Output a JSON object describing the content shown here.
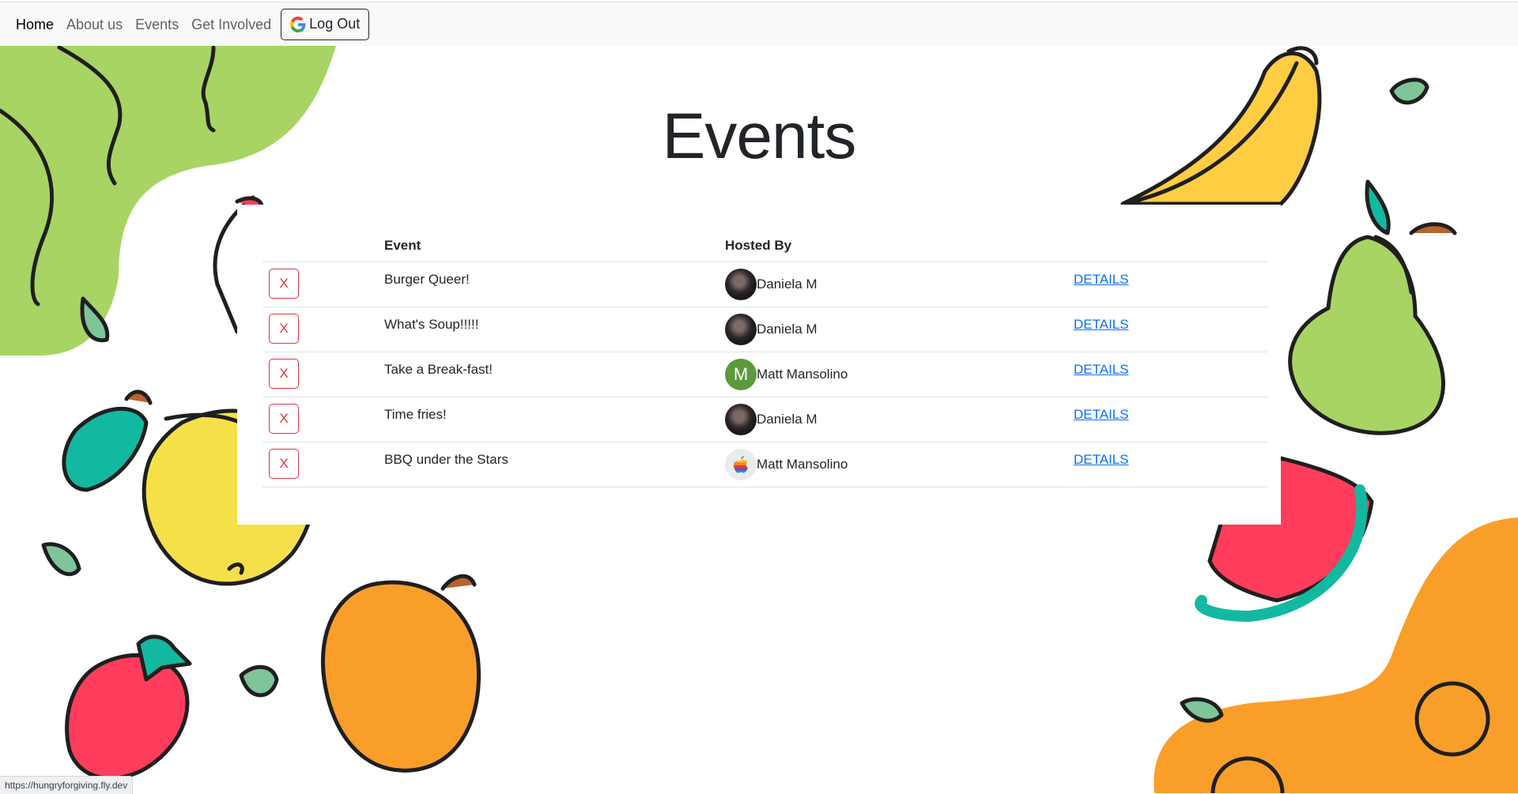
{
  "nav": {
    "items": [
      {
        "label": "Home",
        "active": true
      },
      {
        "label": "About us",
        "active": false
      },
      {
        "label": "Events",
        "active": false
      },
      {
        "label": "Get Involved",
        "active": false
      }
    ],
    "logout_label": "Log Out",
    "logout_icon": "google-g-icon"
  },
  "page": {
    "title": "Events"
  },
  "table": {
    "headers": [
      "",
      "Event",
      "Hosted By",
      ""
    ],
    "rows": [
      {
        "delete_label": "X",
        "event": "Burger Queer!",
        "host": "Daniela M",
        "avatar": "photo",
        "details": "DETAILS"
      },
      {
        "delete_label": "X",
        "event": "What's Soup!!!!!",
        "host": "Daniela M",
        "avatar": "photo",
        "details": "DETAILS"
      },
      {
        "delete_label": "X",
        "event": "Take a Break-fast!",
        "host": "Matt Mansolino",
        "avatar": "letter",
        "avatar_letter": "M",
        "details": "DETAILS"
      },
      {
        "delete_label": "X",
        "event": "Time fries!",
        "host": "Daniela M",
        "avatar": "photo",
        "details": "DETAILS"
      },
      {
        "delete_label": "X",
        "event": "BBQ under the Stars",
        "host": "Matt Mansolino",
        "avatar": "apple",
        "details": "DETAILS"
      }
    ]
  },
  "status_bar": {
    "url": "https://hungryforgiving.fly.dev"
  },
  "colors": {
    "danger": "#dc3545",
    "link": "#0d6efd",
    "letter_avatar": "#5a9a3c",
    "fruit_green": "#a8d464",
    "fruit_yellow": "#f5e04a",
    "fruit_orange": "#fa9e2a",
    "fruit_red": "#ff3c5c",
    "fruit_teal": "#12b9a0"
  }
}
